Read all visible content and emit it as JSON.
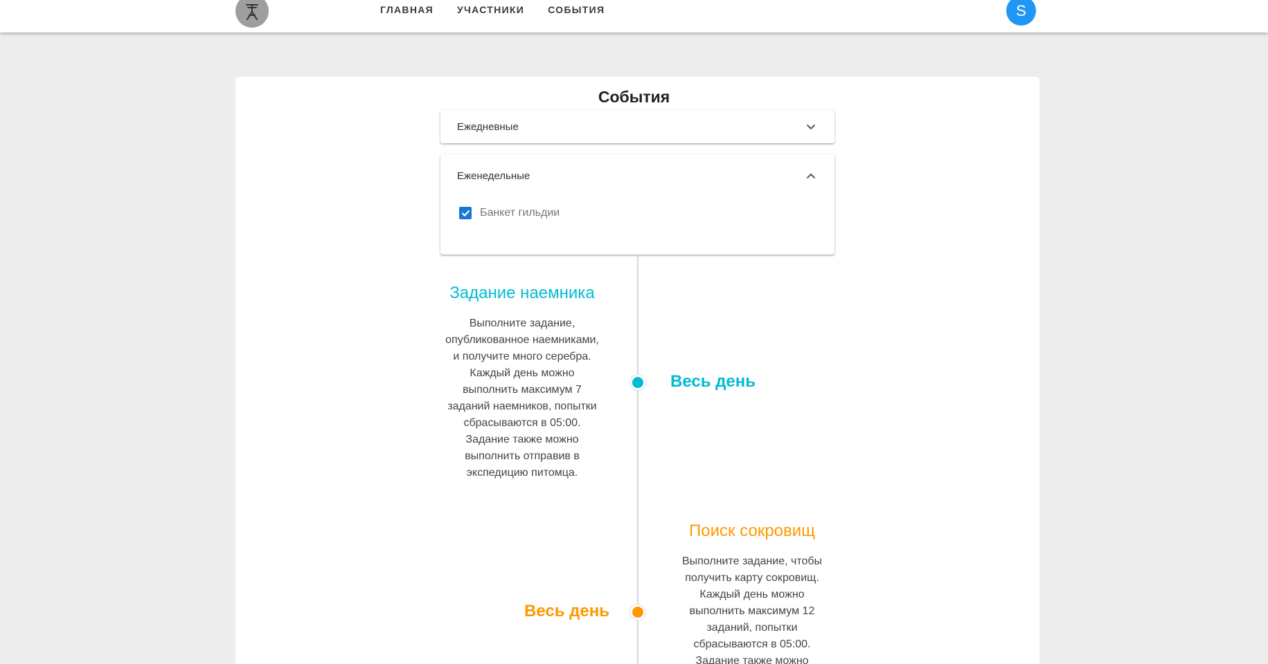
{
  "nav": {
    "items": [
      "ГЛАВНАЯ",
      "УЧАСТНИКИ",
      "СОБЫТИЯ"
    ],
    "avatar_letter": "S"
  },
  "page": {
    "title": "События"
  },
  "panels": {
    "daily": {
      "label": "Ежедневные",
      "expanded": false
    },
    "weekly": {
      "label": "Еженедельные",
      "expanded": true,
      "options": [
        {
          "label": "Банкет гильдии",
          "checked": true
        }
      ]
    }
  },
  "events": [
    {
      "title": "Задание наемника",
      "description_lines": [
        "Выполните задание,",
        "опубликованное наемниками,",
        "и получите много серебра.",
        "Каждый день можно",
        "выполнить максимум 7",
        "заданий наемников, попытки",
        "сбрасываются в 05:00.",
        "Задание также можно",
        "выполнить отправив в",
        "экспедицию питомца."
      ],
      "time": "Весь день",
      "color": "#00bcd4"
    },
    {
      "title": "Поиск сокровищ",
      "description_lines": [
        "Выполните задание, чтобы",
        "получить карту сокровищ.",
        "Каждый день можно",
        "выполнить максимум 12",
        "заданий, попытки",
        "сбрасываются в 05:00.",
        "Задание также можно"
      ],
      "time": "Весь день",
      "color": "#ff9800"
    }
  ],
  "icons": {
    "logo": "tower-logo-icon",
    "daily_chevron": "chevron-down-icon",
    "weekly_chevron": "chevron-up-icon",
    "checkbox": "checkmark-icon"
  }
}
